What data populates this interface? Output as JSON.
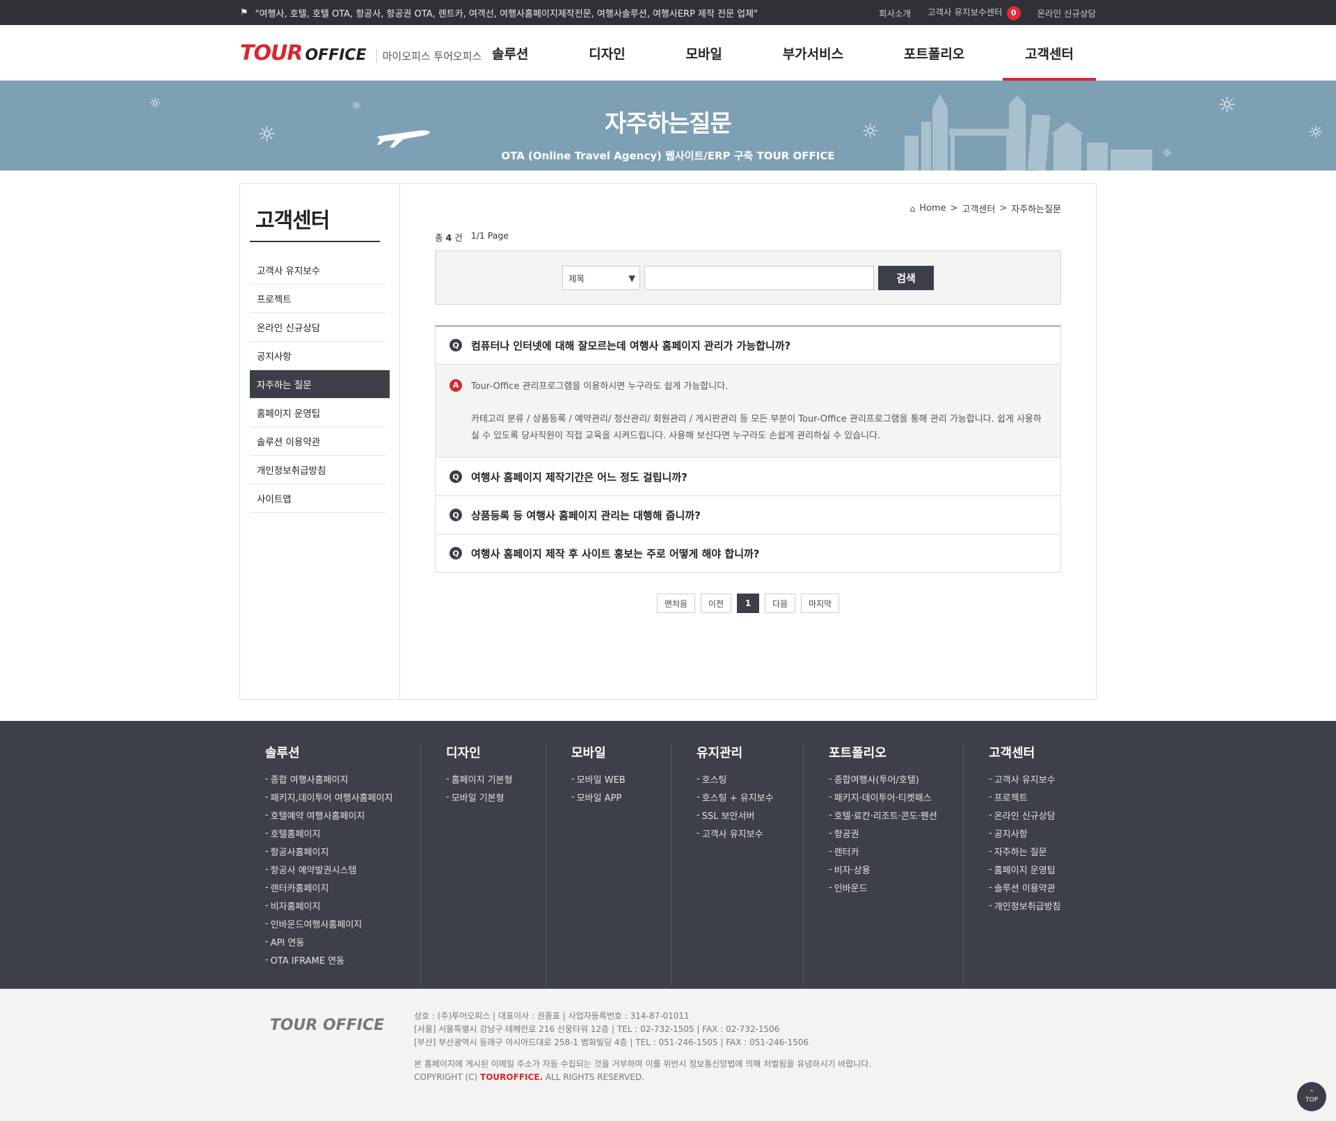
{
  "topbar": {
    "slogan": "\"여행사, 호텔, 호텔 OTA, 항공사, 항공권 OTA, 렌트카, 여객선, 여행사홈페이지제작전문, 여행사솔루션, 여행사ERP 제작 전문 업체\"",
    "links": [
      "회사소개",
      "고객사 유지보수센터",
      "온라인 신규상담"
    ],
    "badge_count": "0"
  },
  "header": {
    "logo_tour": "TOUR",
    "logo_office": "OFFICE",
    "logo_sub": "마이오피스 투어오피스",
    "nav": [
      "솔루션",
      "디자인",
      "모바일",
      "부가서비스",
      "포트폴리오",
      "고객센터"
    ]
  },
  "banner": {
    "title": "자주하는질문",
    "subtitle": "OTA (Online Travel Agency) 웹사이트/ERP 구축 TOUR OFFICE"
  },
  "sidebar": {
    "title": "고객센터",
    "items": [
      "고객사 유지보수",
      "프로젝트",
      "온라인 신규상담",
      "공지사항",
      "자주하는 질문",
      "홈페이지 운영팁",
      "솔루션 이용약관",
      "개인정보취급방침",
      "사이트맵"
    ],
    "active_index": 4
  },
  "breadcrumb": {
    "home": "Home",
    "section": "고객센터",
    "current": "자주하는질문"
  },
  "count": {
    "total_prefix": "총",
    "total": "4",
    "total_suffix": "건",
    "page": "1/1 Page"
  },
  "search": {
    "select_value": "제목",
    "button": "검색",
    "input_value": ""
  },
  "faq": {
    "q_mark": "Q",
    "a_mark": "A",
    "items": [
      "컴퓨터나 인터넷에 대해 잘모르는데 여행사 홈페이지 관리가 가능합니까?",
      "여행사 홈페이지 제작기간은 어느 정도 걸립니까?",
      "상품등록 등 여행사 홈페이지 관리는 대행해 줍니까?",
      "여행사 홈페이지 제작 후 사이트 홍보는 주로 어떻게 해야 합니까?"
    ],
    "answer_lead": "Tour-Office 관리프로그램을 이용하시면 누구라도 쉽게 가능합니다.",
    "answer_body": "카테고리 분류 / 상품등록 / 예약관리/ 정산관리/ 회원관리 / 게시판관리 등 모든 부분이 Tour-Office 관리프로그램을 통해 관리 가능합니다. 쉽게 사용하실 수 있도록 당사직원이 직접 교육을 시켜드립니다. 사용해 보신다면 누구라도 손쉽게 관리하실 수 있습니다."
  },
  "paging": {
    "first": "맨처음",
    "prev": "이전",
    "current": "1",
    "next": "다음",
    "last": "마지막"
  },
  "footer_nav": [
    {
      "title": "솔루션",
      "items": [
        "종합 여행사홈페이지",
        "패키지,데이투어 여행사홈페이지",
        "호텔예약 여행사홈페이지",
        "호텔홈페이지",
        "항공사홈페이지",
        "항공사 예약발권시스템",
        "렌터카홈페이지",
        "비자홈페이지",
        "인바운드여행사홈페이지",
        "API 연동",
        "OTA IFRAME 연동"
      ]
    },
    {
      "title": "디자인",
      "items": [
        "홈페이지 기본형",
        "모바일 기본형"
      ]
    },
    {
      "title": "모바일",
      "items": [
        "모바일 WEB",
        "모바일 APP"
      ]
    },
    {
      "title": "유지관리",
      "items": [
        "호스팅",
        "호스팅 + 유지보수",
        "SSL 보안서버",
        "고객사 유지보수"
      ]
    },
    {
      "title": "포트폴리오",
      "items": [
        "종합여행사(투어/호텔)",
        "패키지·데이투어·티켓패스",
        "호텔·료칸·리조트·콘도·펜션",
        "항공권",
        "렌터카",
        "비자·상용",
        "인바운드"
      ]
    },
    {
      "title": "고객센터",
      "items": [
        "고객사 유지보수",
        "프로젝트",
        "온라인 신규상담",
        "공지사항",
        "자주하는 질문",
        "홈페이지 운영팁",
        "솔루션 이용약관",
        "개인정보취급방침"
      ]
    }
  ],
  "footer": {
    "logo": "TOUR OFFICE",
    "line1": "상호 : (주)투어오피스  |  대표이사 : 권종표  |  사업자등록번호 : 314-87-01011",
    "line2": "[서울] 서울특별시 강남구 테헤란로 216 신웅타워 12층  |  TEL : 02-732-1505  |  FAX : 02-732-1506",
    "line3": "[부산] 부산광역시 동래구 아시아드대로 258-1 범화빌딩 4층  |  TEL : 051-246-1505  |  FAX : 051-246-1506",
    "notice": "본 홈페이지에 게시된 이메일 주소가 자동 수집되는 것을 거부하며 이를 위반시 정보통신망법에 의해 처벌됨을 유념하시기 바랍니다.",
    "copy_prefix": "COPYRIGHT (C)",
    "copy_brand": "TOUROFFICE.",
    "copy_suffix": "ALL RIGHTS RESERVED.",
    "top_button": "TOP"
  },
  "colors": {
    "accent": "#d7282f",
    "dark": "#3c3f48",
    "banner": "#7ea0b4",
    "footer_bg": "#3d3f4b"
  }
}
